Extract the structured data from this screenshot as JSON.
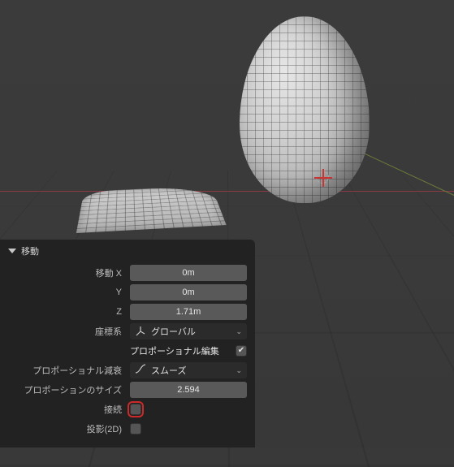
{
  "panel": {
    "title": "移動",
    "move": {
      "x_label": "移動 X",
      "y_label": "Y",
      "z_label": "Z",
      "x": "0m",
      "y": "0m",
      "z": "1.71m"
    },
    "orientation": {
      "label": "座標系",
      "value": "グローバル"
    },
    "proportional": {
      "section_label": "プロポーショナル編集",
      "section_checked": true,
      "falloff_label": "プロポーショナル減衰",
      "falloff_value": "スムーズ",
      "size_label": "プロポーションのサイズ",
      "size_value": "2.594",
      "connected_label": "接続",
      "connected_checked": false,
      "projected_label": "投影(2D)",
      "projected_checked": false
    }
  }
}
